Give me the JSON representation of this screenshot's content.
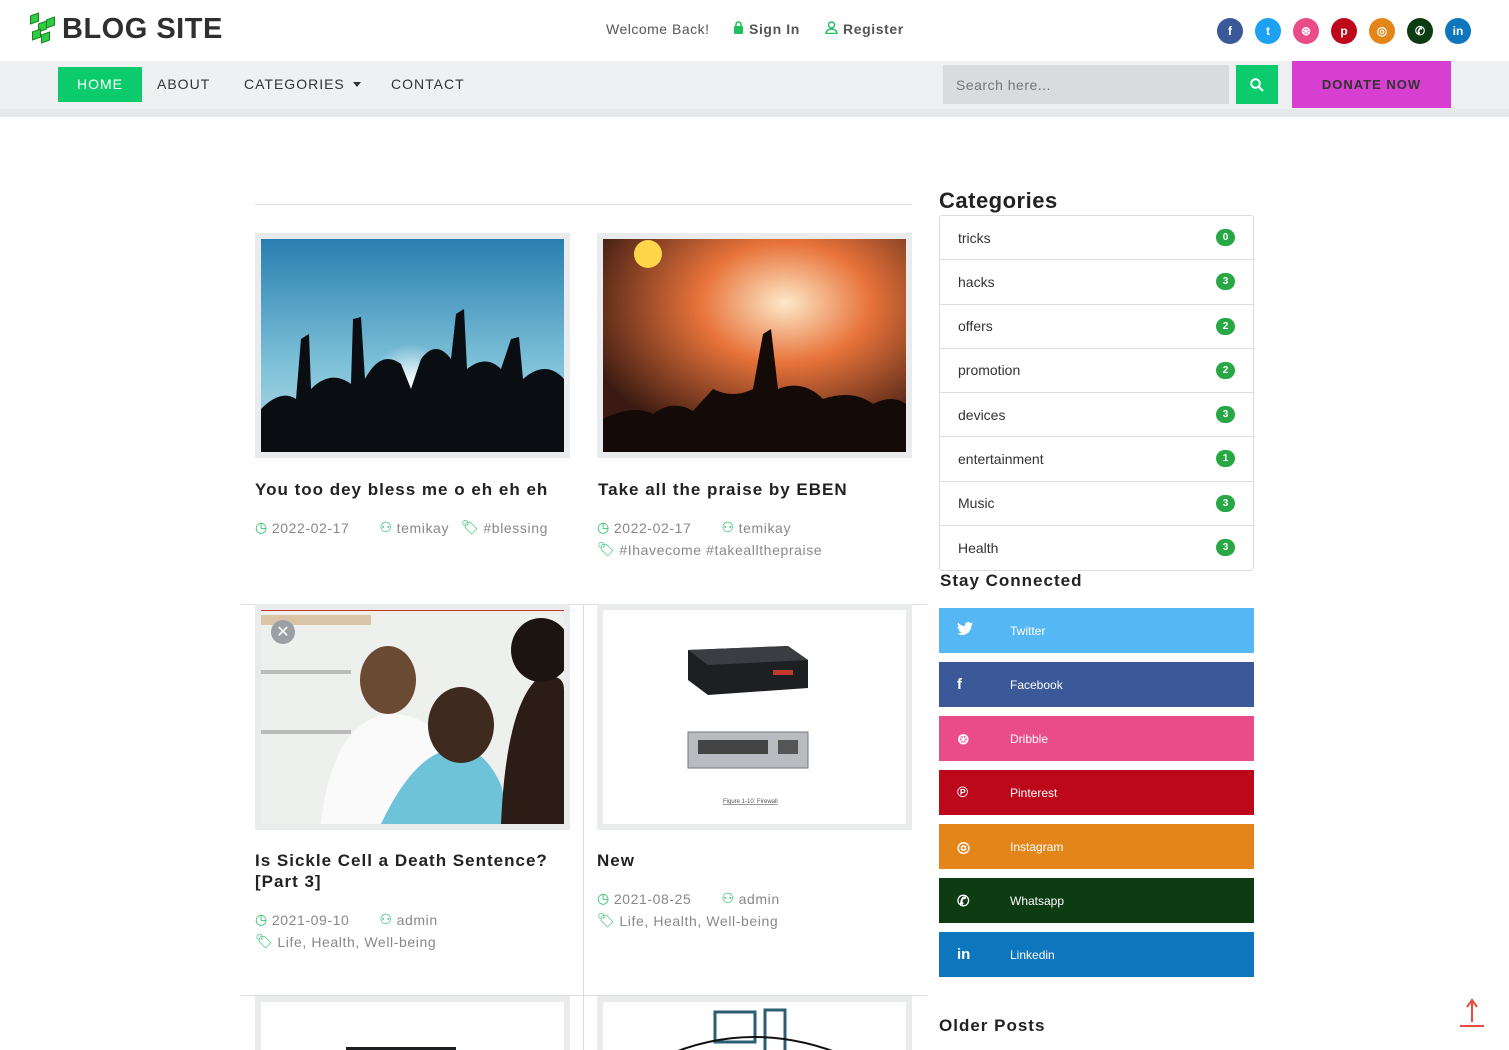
{
  "header": {
    "logo_text": "BLOG SITE",
    "welcome": "Welcome Back!",
    "sign_in": "Sign In",
    "register": "Register",
    "socials": [
      {
        "name": "facebook",
        "glyph": "f",
        "color": "#3b5998"
      },
      {
        "name": "twitter",
        "glyph": "t",
        "color": "#1da1f2"
      },
      {
        "name": "dribbble",
        "glyph": "⊛",
        "color": "#ea4c89"
      },
      {
        "name": "pinterest",
        "glyph": "p",
        "color": "#bd081c"
      },
      {
        "name": "instagram",
        "glyph": "◎",
        "color": "#e4851a"
      },
      {
        "name": "whatsapp",
        "glyph": "✆",
        "color": "#0d3b12"
      },
      {
        "name": "linkedin",
        "glyph": "in",
        "color": "#0e76bd"
      }
    ]
  },
  "nav": {
    "home": "HOME",
    "about": "ABOUT",
    "categories": "CATEGORIES",
    "contact": "CONTACT",
    "search_placeholder": "Search here...",
    "donate": "DONATE NOW"
  },
  "posts": [
    {
      "title": "You too dey bless me o eh eh eh",
      "date": "2022-02-17",
      "author": "temikay",
      "tags": "#blessing"
    },
    {
      "title": "Take all the praise by EBEN",
      "date": "2022-02-17",
      "author": "temikay",
      "tags": "#Ihavecome #takeallthepraise"
    },
    {
      "title_line1": "Is Sickle Cell a Death Sentence?",
      "title_line2": "[Part 3]",
      "date": "2021-09-10",
      "author": "admin",
      "tags": "Life, Health, Well-being"
    },
    {
      "title": "New",
      "date": "2021-08-25",
      "author": "admin",
      "tags": "Life, Health, Well-being",
      "figure_caption": "Figure 1-10: Firewall"
    }
  ],
  "sidebar": {
    "categories_heading": "Categories",
    "categories": [
      {
        "name": "tricks",
        "count": "0"
      },
      {
        "name": "hacks",
        "count": "3"
      },
      {
        "name": "offers",
        "count": "2"
      },
      {
        "name": "promotion",
        "count": "2"
      },
      {
        "name": "devices",
        "count": "3"
      },
      {
        "name": "entertainment",
        "count": "1"
      },
      {
        "name": "Music",
        "count": "3"
      },
      {
        "name": "Health",
        "count": "3"
      }
    ],
    "stay_connected": "Stay Connected",
    "connect": [
      {
        "label": "Twitter",
        "glyph": "🐦",
        "color": "#55b7f3"
      },
      {
        "label": "Facebook",
        "glyph": "f",
        "color": "#3b5998"
      },
      {
        "label": "Dribble",
        "glyph": "⊛",
        "color": "#ea4c89"
      },
      {
        "label": "Pinterest",
        "glyph": "℗",
        "color": "#bd081c"
      },
      {
        "label": "Instagram",
        "glyph": "◎",
        "color": "#e4851a"
      },
      {
        "label": "Whatsapp",
        "glyph": "✆",
        "color": "#0d3b12"
      },
      {
        "label": "Linkedin",
        "glyph": "in",
        "color": "#0e76bd"
      }
    ],
    "older_posts": "Older Posts"
  }
}
